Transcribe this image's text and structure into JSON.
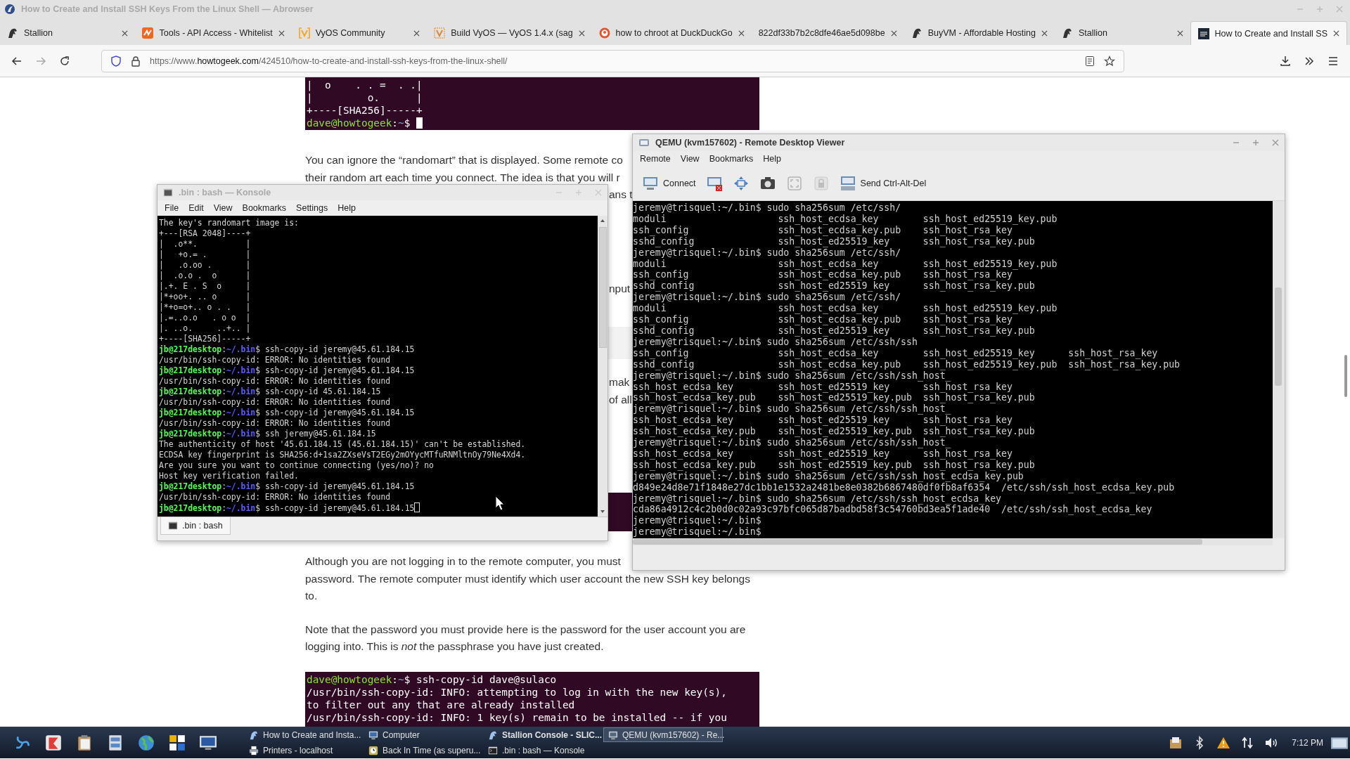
{
  "browser": {
    "title": "How to Create and Install SSH Keys From the Linux Shell — Abrowser",
    "tabs": [
      {
        "label": "Stallion",
        "kind": "horse",
        "selected": false
      },
      {
        "label": "Tools - API Access - Whitelist",
        "kind": "api",
        "selected": false
      },
      {
        "label": "VyOS Community",
        "kind": "vyos",
        "selected": false
      },
      {
        "label": "Build VyOS — VyOS 1.4.x (sag",
        "kind": "build",
        "selected": false
      },
      {
        "label": "how to chroot at DuckDuckGo",
        "kind": "duck",
        "selected": false
      },
      {
        "label": "822df33b7b2c8dfe46ae5d098be",
        "kind": "plain",
        "selected": false
      },
      {
        "label": "BuyVM - Affordable Hosting",
        "kind": "horse",
        "selected": false
      },
      {
        "label": "Stallion",
        "kind": "horse",
        "selected": false
      },
      {
        "label": "How to Create and Install SS",
        "kind": "site",
        "selected": true
      }
    ],
    "back": {
      "disabled": false
    },
    "forward": {
      "disabled": true
    },
    "url": {
      "scheme": "https://www.",
      "domain": "howtogeek.com",
      "path": "/424510/how-to-create-and-install-ssh-keys-from-the-linux-shell/"
    }
  },
  "article": [
    {
      "kind": "code",
      "lines": [
        {
          "parts": [
            {
              "kind": "plain",
              "text": "|  o    . . =  . .|"
            }
          ],
          "cursor": false
        },
        {
          "parts": [
            {
              "kind": "plain",
              "text": "|         o.      |"
            }
          ],
          "cursor": false
        },
        {
          "parts": [
            {
              "kind": "plain",
              "text": "+----[SHA256]-----+"
            }
          ],
          "cursor": false
        },
        {
          "parts": [
            {
              "kind": "user",
              "text": "dave@howtogeek"
            },
            {
              "kind": "plain",
              "text": ":"
            },
            {
              "kind": "path",
              "text": "~"
            },
            {
              "kind": "plain",
              "text": "$ "
            }
          ],
          "cursor": true
        }
      ]
    },
    {
      "kind": "text",
      "lines": [
        "You can ignore the “randomart” that is displayed. Some remote co",
        "their random art each time you connect. The idea is that you will r"
      ]
    },
    {
      "kind": "fragment",
      "lines": [
        "ans t"
      ]
    },
    {
      "kind": "fragment",
      "lines": [
        "nput"
      ]
    },
    {
      "kind": "panel"
    },
    {
      "kind": "fragment",
      "lines": [
        "mak",
        "of all"
      ]
    },
    {
      "kind": "dark-panel"
    },
    {
      "kind": "text",
      "lines": [
        "Although you are not logging in to the remote computer, you must",
        "password. The remote computer must identify which user account the new SSH key belongs",
        "to."
      ]
    },
    {
      "kind": "text",
      "lines": [
        "Note that the password you must provide here is the password for the user account you are",
        "logging into. This is *not* the passphrase you have just created."
      ]
    },
    {
      "kind": "code",
      "lines": [
        {
          "parts": [
            {
              "kind": "user",
              "text": "dave@howtogeek"
            },
            {
              "kind": "plain",
              "text": ":"
            },
            {
              "kind": "path",
              "text": "~"
            },
            {
              "kind": "plain",
              "text": "$ ssh-copy-id dave@sulaco"
            }
          ],
          "cursor": false
        },
        {
          "parts": [
            {
              "kind": "plain",
              "text": "/usr/bin/ssh-copy-id: INFO: attempting to log in with the new key(s),"
            }
          ],
          "cursor": false
        },
        {
          "parts": [
            {
              "kind": "plain",
              "text": "to filter out any that are already installed"
            }
          ],
          "cursor": false
        },
        {
          "parts": [
            {
              "kind": "plain",
              "text": "/usr/bin/ssh-copy-id: INFO: 1 key(s) remain to be installed -- if you"
            }
          ],
          "cursor": false
        }
      ]
    }
  ],
  "konsole": {
    "title": ".bin : bash — Konsole",
    "menu": [
      "File",
      "Edit",
      "View",
      "Bookmarks",
      "Settings",
      "Help"
    ],
    "tab": ".bin : bash",
    "lines": [
      {
        "parts": [
          {
            "kind": "plain",
            "text": "The key's randomart image is:"
          }
        ],
        "cursor": false
      },
      {
        "parts": [
          {
            "kind": "plain",
            "text": "+---[RSA 2048]----+"
          }
        ],
        "cursor": false
      },
      {
        "parts": [
          {
            "kind": "plain",
            "text": "|  .o**.          |"
          }
        ],
        "cursor": false
      },
      {
        "parts": [
          {
            "kind": "plain",
            "text": "|   +o.= .        |"
          }
        ],
        "cursor": false
      },
      {
        "parts": [
          {
            "kind": "plain",
            "text": "|   .o.oo .       |"
          }
        ],
        "cursor": false
      },
      {
        "parts": [
          {
            "kind": "plain",
            "text": "|  .o.o .  o      |"
          }
        ],
        "cursor": false
      },
      {
        "parts": [
          {
            "kind": "plain",
            "text": "|.+. E . S  o     |"
          }
        ],
        "cursor": false
      },
      {
        "parts": [
          {
            "kind": "plain",
            "text": "|*+oo+. .. o      |"
          }
        ],
        "cursor": false
      },
      {
        "parts": [
          {
            "kind": "plain",
            "text": "|*+o=o+.. o . .   |"
          }
        ],
        "cursor": false
      },
      {
        "parts": [
          {
            "kind": "plain",
            "text": "|.=..o.o   . o o  |"
          }
        ],
        "cursor": false
      },
      {
        "parts": [
          {
            "kind": "plain",
            "text": "|. ..o.     ..+.. |"
          }
        ],
        "cursor": false
      },
      {
        "parts": [
          {
            "kind": "plain",
            "text": "+----[SHA256]-----+"
          }
        ],
        "cursor": false
      },
      {
        "parts": [
          {
            "kind": "user",
            "text": "jb@217desktop"
          },
          {
            "kind": "plain",
            "text": ":"
          },
          {
            "kind": "path",
            "text": "~/.bin"
          },
          {
            "kind": "plain",
            "text": "$ ssh-copy-id jeremy@45.61.184.15"
          }
        ],
        "cursor": false
      },
      {
        "parts": [
          {
            "kind": "plain",
            "text": "/usr/bin/ssh-copy-id: ERROR: No identities found"
          }
        ],
        "cursor": false
      },
      {
        "parts": [
          {
            "kind": "user",
            "text": "jb@217desktop"
          },
          {
            "kind": "plain",
            "text": ":"
          },
          {
            "kind": "path",
            "text": "~/.bin"
          },
          {
            "kind": "plain",
            "text": "$ ssh-copy-id jeremy@45.61.184.15"
          }
        ],
        "cursor": false
      },
      {
        "parts": [
          {
            "kind": "plain",
            "text": "/usr/bin/ssh-copy-id: ERROR: No identities found"
          }
        ],
        "cursor": false
      },
      {
        "parts": [
          {
            "kind": "user",
            "text": "jb@217desktop"
          },
          {
            "kind": "plain",
            "text": ":"
          },
          {
            "kind": "path",
            "text": "~/.bin"
          },
          {
            "kind": "plain",
            "text": "$ ssh-copy-id 45.61.184.15"
          }
        ],
        "cursor": false
      },
      {
        "parts": [
          {
            "kind": "plain",
            "text": "/usr/bin/ssh-copy-id: ERROR: No identities found"
          }
        ],
        "cursor": false
      },
      {
        "parts": [
          {
            "kind": "user",
            "text": "jb@217desktop"
          },
          {
            "kind": "plain",
            "text": ":"
          },
          {
            "kind": "path",
            "text": "~/.bin"
          },
          {
            "kind": "plain",
            "text": "$ ssh-copy-id jeremy@45.61.184.15"
          }
        ],
        "cursor": false
      },
      {
        "parts": [
          {
            "kind": "plain",
            "text": "/usr/bin/ssh-copy-id: ERROR: No identities found"
          }
        ],
        "cursor": false
      },
      {
        "parts": [
          {
            "kind": "user",
            "text": "jb@217desktop"
          },
          {
            "kind": "plain",
            "text": ":"
          },
          {
            "kind": "path",
            "text": "~/.bin"
          },
          {
            "kind": "plain",
            "text": "$ ssh jeremy@45.61.184.15"
          }
        ],
        "cursor": false
      },
      {
        "parts": [
          {
            "kind": "plain",
            "text": "The authenticity of host '45.61.184.15 (45.61.184.15)' can't be established."
          }
        ],
        "cursor": false
      },
      {
        "parts": [
          {
            "kind": "plain",
            "text": "ECDSA key fingerprint is SHA256:d+1sa2ZXseVsT2EGy2mOYycMTfuRNMltnOy79Ne4Xd4."
          }
        ],
        "cursor": false
      },
      {
        "parts": [
          {
            "kind": "plain",
            "text": "Are you sure you want to continue connecting (yes/no)? no"
          }
        ],
        "cursor": false
      },
      {
        "parts": [
          {
            "kind": "plain",
            "text": "Host key verification failed."
          }
        ],
        "cursor": false
      },
      {
        "parts": [
          {
            "kind": "user",
            "text": "jb@217desktop"
          },
          {
            "kind": "plain",
            "text": ":"
          },
          {
            "kind": "path",
            "text": "~/.bin"
          },
          {
            "kind": "plain",
            "text": "$ ssh-copy-id jeremy@45.61.184.15"
          }
        ],
        "cursor": false
      },
      {
        "parts": [
          {
            "kind": "plain",
            "text": "/usr/bin/ssh-copy-id: ERROR: No identities found"
          }
        ],
        "cursor": false
      },
      {
        "parts": [
          {
            "kind": "user",
            "text": "jb@217desktop"
          },
          {
            "kind": "plain",
            "text": ":"
          },
          {
            "kind": "path",
            "text": "~/.bin"
          },
          {
            "kind": "plain",
            "text": "$ ssh-copy-id jeremy@45.61.184.15"
          }
        ],
        "cursor": true
      }
    ]
  },
  "viewer": {
    "title": "QEMU (kvm157602) - Remote Desktop Viewer",
    "menu": [
      "Remote",
      "View",
      "Bookmarks",
      "Help"
    ],
    "tools": [
      {
        "kind": "connect",
        "label": "Connect",
        "disabled": false
      },
      {
        "kind": "disconnect",
        "disabled": false
      },
      {
        "kind": "move",
        "disabled": false
      },
      {
        "kind": "screenshot",
        "disabled": false
      },
      {
        "kind": "fit",
        "disabled": true
      },
      {
        "kind": "lock",
        "disabled": true
      },
      {
        "kind": "keys",
        "label": "Send Ctrl-Alt-Del",
        "disabled": false
      }
    ],
    "lines": [
      {
        "kind": "text",
        "text": "jeremy@trisquel:~/.bin$ sudo sha256sum /etc/ssh/"
      },
      {
        "kind": "columns",
        "cells": [
          "moduli",
          "ssh_host_ecdsa_key",
          "ssh_host_ed25519_key.pub"
        ]
      },
      {
        "kind": "columns",
        "cells": [
          "ssh_config",
          "ssh_host_ecdsa_key.pub",
          "ssh_host_rsa_key"
        ]
      },
      {
        "kind": "columns",
        "cells": [
          "sshd_config",
          "ssh_host_ed25519_key",
          "ssh_host_rsa_key.pub"
        ]
      },
      {
        "kind": "text",
        "text": "jeremy@trisquel:~/.bin$ sudo sha256sum /etc/ssh/"
      },
      {
        "kind": "columns",
        "cells": [
          "moduli",
          "ssh_host_ecdsa_key",
          "ssh_host_ed25519_key.pub"
        ]
      },
      {
        "kind": "columns",
        "cells": [
          "ssh_config",
          "ssh_host_ecdsa_key.pub",
          "ssh_host_rsa_key"
        ]
      },
      {
        "kind": "columns",
        "cells": [
          "sshd_config",
          "ssh_host_ed25519_key",
          "ssh_host_rsa_key.pub"
        ]
      },
      {
        "kind": "text",
        "text": "jeremy@trisquel:~/.bin$ sudo sha256sum /etc/ssh/"
      },
      {
        "kind": "columns",
        "cells": [
          "moduli",
          "ssh_host_ecdsa_key",
          "ssh_host_ed25519_key.pub"
        ]
      },
      {
        "kind": "columns",
        "cells": [
          "ssh_config",
          "ssh_host_ecdsa_key.pub",
          "ssh_host_rsa_key"
        ]
      },
      {
        "kind": "columns",
        "cells": [
          "sshd_config",
          "ssh_host_ed25519_key",
          "ssh_host_rsa_key.pub"
        ]
      },
      {
        "kind": "text",
        "text": "jeremy@trisquel:~/.bin$ sudo sha256sum /etc/ssh/ssh"
      },
      {
        "kind": "columns",
        "cells": [
          "ssh_config",
          "ssh_host_ecdsa_key",
          "ssh_host_ed25519_key",
          "ssh_host_rsa_key"
        ]
      },
      {
        "kind": "columns",
        "cells": [
          "sshd_config",
          "ssh_host_ecdsa_key.pub",
          "ssh_host_ed25519_key.pub",
          "ssh_host_rsa_key.pub"
        ]
      },
      {
        "kind": "text",
        "text": "jeremy@trisquel:~/.bin$ sudo sha256sum /etc/ssh/ssh_host_"
      },
      {
        "kind": "columns",
        "cells": [
          "ssh_host_ecdsa_key",
          "ssh_host_ed25519_key",
          "ssh_host_rsa_key"
        ]
      },
      {
        "kind": "columns",
        "cells": [
          "ssh_host_ecdsa_key.pub",
          "ssh_host_ed25519_key.pub",
          "ssh_host_rsa_key.pub"
        ]
      },
      {
        "kind": "text",
        "text": "jeremy@trisquel:~/.bin$ sudo sha256sum /etc/ssh/ssh_host_"
      },
      {
        "kind": "columns",
        "cells": [
          "ssh_host_ecdsa_key",
          "ssh_host_ed25519_key",
          "ssh_host_rsa_key"
        ]
      },
      {
        "kind": "columns",
        "cells": [
          "ssh_host_ecdsa_key.pub",
          "ssh_host_ed25519_key.pub",
          "ssh_host_rsa_key.pub"
        ]
      },
      {
        "kind": "text",
        "text": "jeremy@trisquel:~/.bin$ sudo sha256sum /etc/ssh/ssh_host_"
      },
      {
        "kind": "columns",
        "cells": [
          "ssh_host_ecdsa_key",
          "ssh_host_ed25519_key",
          "ssh_host_rsa_key"
        ]
      },
      {
        "kind": "columns",
        "cells": [
          "ssh_host_ecdsa_key.pub",
          "ssh_host_ed25519_key.pub",
          "ssh_host_rsa_key.pub"
        ]
      },
      {
        "kind": "text",
        "text": "jeremy@trisquel:~/.bin$ sudo sha256sum /etc/ssh/ssh_host_ecdsa_key.pub"
      },
      {
        "kind": "text",
        "text": "d849e24d8e71f1848e27dc1bb1e1532a2481be8e0382b6867480df0fb8af6354  /etc/ssh/ssh_host_ecdsa_key.pub"
      },
      {
        "kind": "text",
        "text": "jeremy@trisquel:~/.bin$ sudo sha256sum /etc/ssh/ssh_host_ecdsa_key"
      },
      {
        "kind": "text",
        "text": "cda86a4912c4c2b0d0c02a93c97bfc065d87badbd58f3c54760bd3ea5f1ade40  /etc/ssh/ssh_host_ecdsa_key"
      },
      {
        "kind": "text",
        "text": "jeremy@trisquel:~/.bin$"
      },
      {
        "kind": "text",
        "text": "jeremy@trisquel:~/.bin$"
      }
    ]
  },
  "taskbar": {
    "tasks": [
      {
        "label": "How to Create and Insta...",
        "kind": "browser",
        "selected": false,
        "attention": false
      },
      {
        "label": "Computer",
        "kind": "computer",
        "selected": false,
        "attention": false
      },
      {
        "label": "Stallion Console - SLIC...",
        "kind": "browser",
        "selected": false,
        "attention": true
      },
      {
        "label": "QEMU (kvm157602) - Re...",
        "kind": "viewer",
        "selected": true,
        "attention": false
      },
      {
        "label": "Printers - localhost",
        "kind": "printer",
        "selected": false,
        "attention": false
      },
      {
        "label": "Back In Time (as superu...",
        "kind": "backup",
        "selected": false,
        "attention": false
      },
      {
        "label": ".bin : bash — Konsole",
        "kind": "terminal",
        "selected": false,
        "attention": false
      }
    ],
    "clock": "7:12 PM"
  }
}
